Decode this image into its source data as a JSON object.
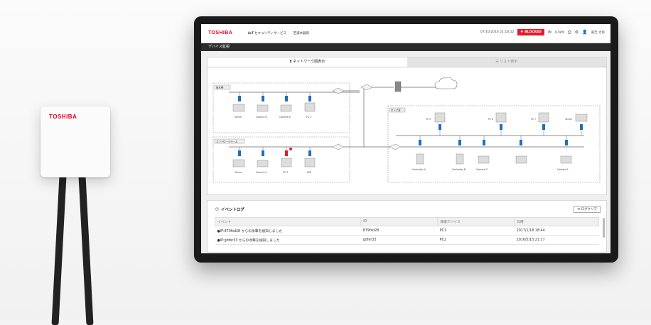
{
  "device": {
    "logo": "TOSHIBA"
  },
  "header": {
    "brand": "TOSHIBA",
    "service_bold": "IoT",
    "service": "セキュリティサービス",
    "company": "芝浦木器商",
    "datetime": "07/10/2016  21:18:52",
    "blocked": "BLOCKED",
    "count": "979件",
    "user": "東芝 太郎"
  },
  "page_title": "デバイス監視",
  "tabs": [
    {
      "label": "ネットワーク図表示",
      "active": true
    },
    {
      "label": "リスト表示",
      "active": false
    }
  ],
  "network": {
    "groups": [
      {
        "label": "製水場"
      },
      {
        "label": "コントロールルーム"
      },
      {
        "label": "ポンプ室"
      }
    ],
    "devices_top": [
      "Server",
      "Camera A",
      "Camera B",
      "PC 2"
    ],
    "devices_ctrl": [
      "Server",
      "Camera C",
      "PC 3",
      "HMI"
    ],
    "devices_pump_top": [
      "PC 5",
      "PC 6",
      "PC 7",
      "Server"
    ],
    "devices_pump_bottom": [
      "Controller A",
      "Controller B",
      "Camera D",
      "Camera E"
    ]
  },
  "events": {
    "title": "イベントログ",
    "clear_label": "ログクリア",
    "columns": [
      "イベント",
      "ID",
      "保護デバイス",
      "日時"
    ],
    "rows": [
      [
        "●IP:879fsd28 からの攻撃を検知しました",
        "879fsd28",
        "PC1",
        "2017/1/18  18:44"
      ],
      [
        "●IP:gdfer33 からの攻撃を検知しました",
        "gdfer33",
        "PC2",
        "2016/5/13  21:17"
      ]
    ]
  },
  "colors": {
    "brand": "#e6001e",
    "alert": "#e8192c",
    "device_blue": "#1f6fb8"
  }
}
